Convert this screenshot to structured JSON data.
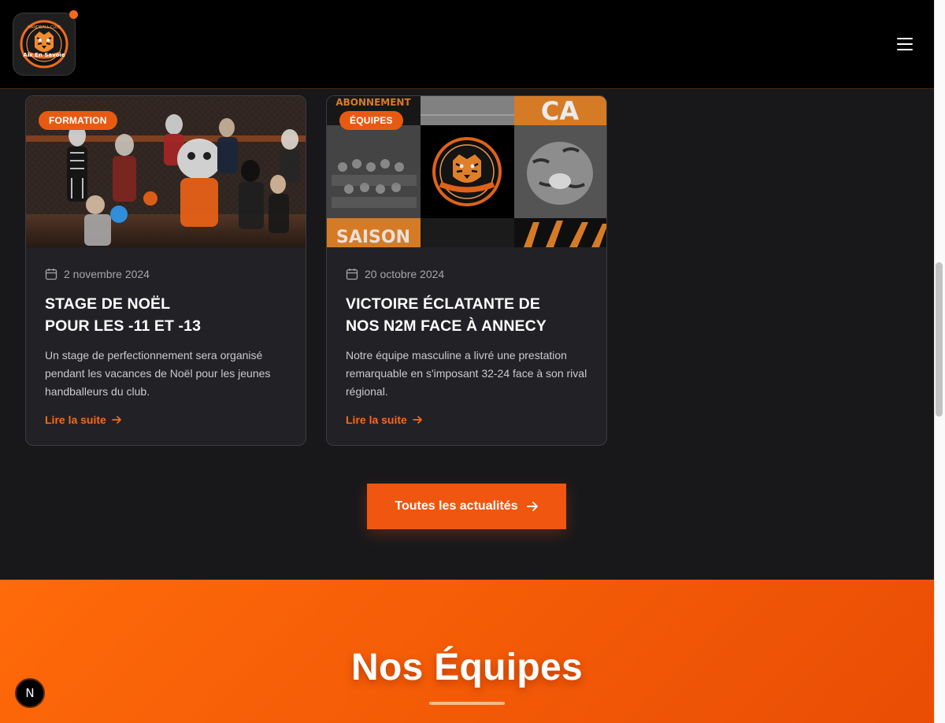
{
  "header": {
    "logo_alt": "Handball Club Aix En Savoie",
    "logo_texts": [
      "HANDBALL CLUB",
      "Aix En Savoie"
    ],
    "menu_icon": "hamburger-icon"
  },
  "news": {
    "cards": [
      {
        "category": "FORMATION",
        "date": "2 novembre 2024",
        "title": "STAGE DE NOËL\nPOUR LES -11 ET -13",
        "description": "Un stage de perfectionnement sera organisé pendant les vacances de Noël pour les jeunes handballeurs du club.",
        "read_more": "Lire la suite"
      },
      {
        "category": "ÉQUIPES",
        "date": "20 octobre 2024",
        "title": "VICTOIRE ÉCLATANTE DE\nNOS N2M FACE À ANNECY",
        "description": "Notre équipe masculine a livré une prestation remarquable en s'imposant 32-24 face à son rival régional.",
        "read_more": "Lire la suite",
        "image_texts": [
          "ABONNEMENT",
          "CA",
          "SAISON"
        ]
      }
    ],
    "all_news_label": "Toutes les actualités"
  },
  "teams": {
    "title": "Nos Équipes"
  },
  "next_badge": "N",
  "colors": {
    "accent": "#f0560f",
    "dark_bg": "#18181b",
    "card_bg": "#222226",
    "header_bg": "#000000"
  }
}
